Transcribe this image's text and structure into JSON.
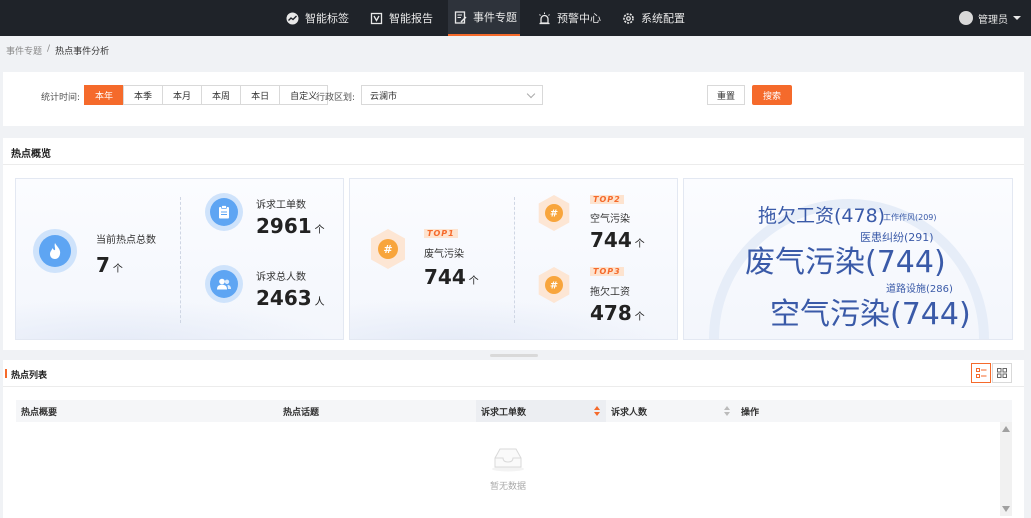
{
  "nav": {
    "items": [
      {
        "label": "智能标签",
        "icon": "chart-icon"
      },
      {
        "label": "智能报告",
        "icon": "report-icon"
      },
      {
        "label": "事件专题",
        "icon": "document-edit-icon"
      },
      {
        "label": "预警中心",
        "icon": "alarm-icon"
      },
      {
        "label": "系统配置",
        "icon": "gear-icon"
      }
    ],
    "active_index": 2,
    "user": "管理员"
  },
  "breadcrumb": {
    "parent": "事件专题",
    "separator": "/",
    "current": "热点事件分析"
  },
  "filter": {
    "time_label": "统计时间:",
    "time_options": [
      "本年",
      "本季",
      "本月",
      "本周",
      "本日",
      "自定义"
    ],
    "time_selected": "本年",
    "region_label": "行政区划:",
    "region_value": "云澜市",
    "reset_label": "重置",
    "search_label": "搜索"
  },
  "overview": {
    "title": "热点概览",
    "total_label": "当前热点总数",
    "total_value": "7",
    "total_unit": "个",
    "orders_label": "诉求工单数",
    "orders_value": "2961",
    "orders_unit": "个",
    "people_label": "诉求总人数",
    "people_value": "2463",
    "people_unit": "人",
    "top1": {
      "badge": "TOP1",
      "name": "废气污染",
      "value": "744",
      "unit": "个"
    },
    "top2": {
      "badge": "TOP2",
      "name": "空气污染",
      "value": "744",
      "unit": "个"
    },
    "top3": {
      "badge": "TOP3",
      "name": "拖欠工资",
      "value": "478",
      "unit": "个"
    },
    "word_cloud": [
      {
        "text": "拖欠工资(478)",
        "count": 478
      },
      {
        "text": "工作作风(209)",
        "count": 209
      },
      {
        "text": "医患纠纷(291)",
        "count": 291
      },
      {
        "text": "废气污染(744)",
        "count": 744
      },
      {
        "text": "道路设施(286)",
        "count": 286
      },
      {
        "text": "空气污染(744)",
        "count": 744
      }
    ]
  },
  "list": {
    "title": "热点列表",
    "columns": [
      "热点概要",
      "热点话题",
      "诉求工单数",
      "诉求人数",
      "操作"
    ],
    "rows": [],
    "empty_text": "暂无数据"
  },
  "colors": {
    "accent": "#f56a2b",
    "nav_bg": "#1f2329",
    "stat_blue": "#5ea5f3",
    "cloud_text": "#3a5aa8"
  }
}
